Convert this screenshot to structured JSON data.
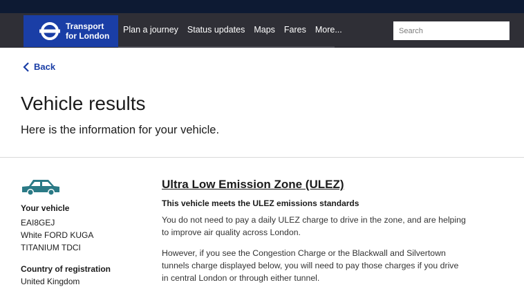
{
  "header": {
    "brand_line1": "Transport",
    "brand_line2": "for London",
    "nav": [
      "Plan a journey",
      "Status updates",
      "Maps",
      "Fares",
      "More..."
    ],
    "search_placeholder": "Search"
  },
  "back_label": "Back",
  "page": {
    "title": "Vehicle results",
    "subtitle": "Here is the information for your vehicle."
  },
  "vehicle": {
    "heading": "Your vehicle",
    "registration": "EAI8GEJ",
    "description": "White FORD KUGA",
    "trim": "TITANIUM TDCI",
    "country_heading": "Country of registration",
    "country": "United Kingdom",
    "icon": "car-icon"
  },
  "ulez": {
    "title": "Ultra Low Emission Zone (ULEZ)",
    "status": "This vehicle meets the ULEZ emissions standards",
    "para1": "You do not need to pay a daily ULEZ charge to drive in the zone, and are helping to improve air quality across London.",
    "para2": "However, if you see the Congestion Charge or the Blackwall and Silvertown tunnels charge displayed below, you will need to pay those charges if you drive in central London or through either tunnel."
  },
  "colors": {
    "brand_blue": "#1a3ea6",
    "nav_bg": "#2f2f36",
    "car_teal": "#2b7a86"
  }
}
